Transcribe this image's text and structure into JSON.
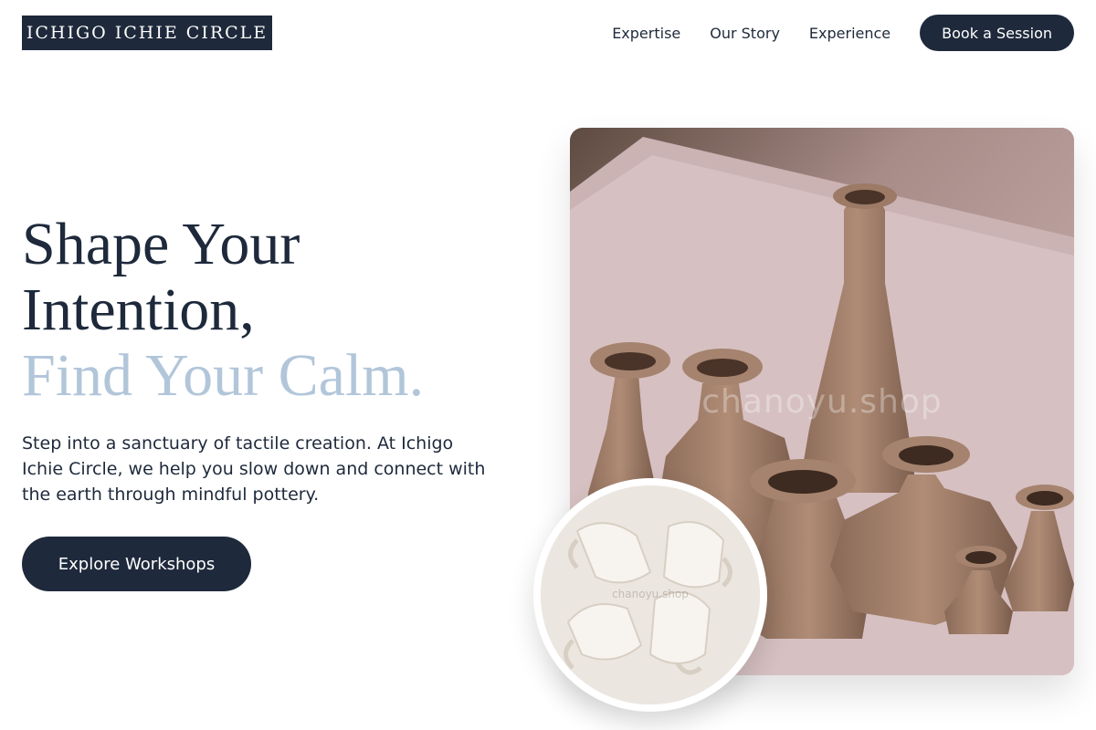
{
  "header": {
    "logo": "ICHIGO ICHIE CIRCLE",
    "nav": [
      "Expertise",
      "Our Story",
      "Experience"
    ],
    "cta": "Book a Session"
  },
  "hero": {
    "title_line1": "Shape Your",
    "title_line2": "Intention,",
    "title_accent": "Find Your Calm.",
    "description": "Step into a sanctuary of tactile creation. At Ichigo Ichie Circle, we help you slow down and connect with the earth through mindful pottery.",
    "button": "Explore Workshops"
  },
  "images": {
    "main_watermark": "chanoyu.shop",
    "circle_watermark": "chanoyu.shop"
  },
  "colors": {
    "primary": "#1e293b",
    "accent": "#b2c6da",
    "background": "#ffffff"
  }
}
